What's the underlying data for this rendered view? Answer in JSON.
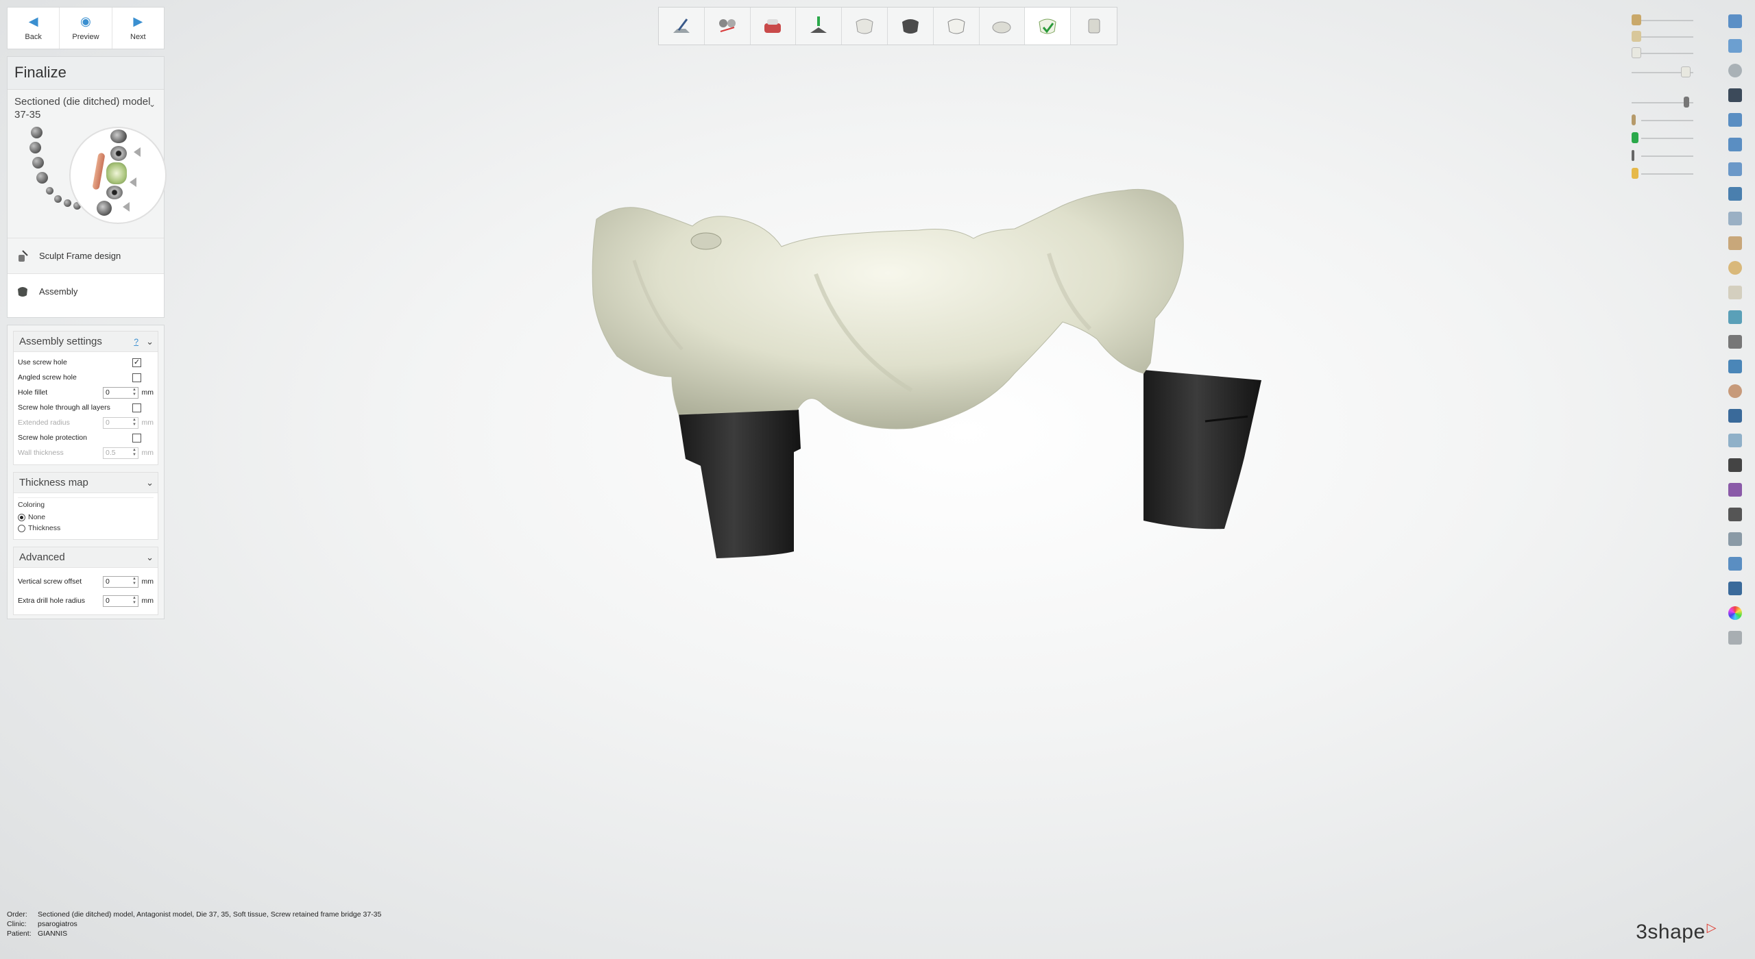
{
  "nav": {
    "back": "Back",
    "preview": "Preview",
    "next": "Next"
  },
  "finalize": {
    "title": "Finalize",
    "model_line1": "Sectioned (die ditched) model",
    "model_line2": "37-35",
    "workflow": [
      {
        "label": "Sculpt Frame design"
      },
      {
        "label": "Assembly"
      }
    ]
  },
  "assembly": {
    "title": "Assembly settings",
    "help": "?",
    "rows": {
      "use_screw_hole": "Use screw hole",
      "angled_screw_hole": "Angled screw hole",
      "hole_fillet": "Hole fillet",
      "hole_fillet_value": "0",
      "screw_hole_all_layers": "Screw hole through all layers",
      "extended_radius": "Extended radius",
      "extended_radius_value": "0",
      "screw_hole_protection": "Screw hole protection",
      "wall_thickness": "Wall thickness",
      "wall_thickness_value": "0.5",
      "unit": "mm"
    },
    "use_screw_hole_checked": true
  },
  "thickness": {
    "title": "Thickness map",
    "coloring": "Coloring",
    "none": "None",
    "thickness": "Thickness",
    "selected": "None"
  },
  "advanced": {
    "title": "Advanced",
    "vertical_offset": "Vertical screw offset",
    "vertical_offset_value": "0",
    "extra_drill": "Extra drill hole radius",
    "extra_drill_value": "0",
    "unit": "mm"
  },
  "footer": {
    "order_key": "Order:",
    "order": "Sectioned (die ditched) model, Antagonist model, Die 37, 35, Soft tissue, Screw retained frame bridge 37-35",
    "clinic_key": "Clinic:",
    "clinic": "psarogiatros",
    "patient_key": "Patient:",
    "patient": "GIANNIS"
  },
  "logo": "3shape",
  "icons": {
    "toolbar": [
      "scan-tool-icon",
      "cut-tool-icon",
      "soft-tissue-icon",
      "die-icon",
      "crown-icon",
      "dark-crown-icon",
      "crown-outline-icon",
      "flat-crown-icon",
      "green-crown-icon",
      "cylinder-icon"
    ],
    "right": [
      "close-icon",
      "fullscreen-icon",
      "rotate-icon",
      "education-icon",
      "layers-icon",
      "copy-icon",
      "paste-icon",
      "view-icon",
      "measure-icon",
      "annotate-icon",
      "ring-icon",
      "cross-section-icon",
      "angle-icon",
      "ruler-icon",
      "box-icon",
      "face-icon",
      "warning-icon",
      "export-icon",
      "camera-icon",
      "purple-bottle-icon",
      "shield-icon",
      "axis-icon",
      "scale-icon",
      "printer-icon",
      "color-wheel-icon",
      "a2-icon"
    ]
  },
  "colors": {
    "accent": "#3a8fd0",
    "model": "#dfe0cc",
    "abutment": "#262626",
    "logo_mark": "#e03a2f"
  }
}
